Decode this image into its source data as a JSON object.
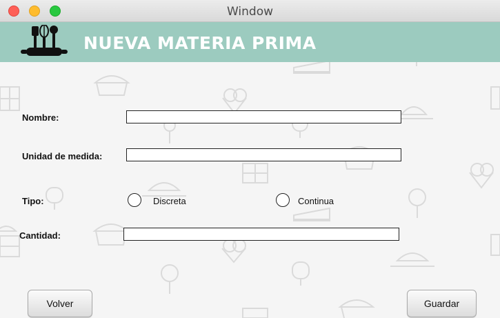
{
  "window": {
    "title": "Window"
  },
  "banner": {
    "title": "NUEVA MATERIA PRIMA",
    "color": "#9ccbbf"
  },
  "form": {
    "nombre": {
      "label": "Nombre:",
      "value": ""
    },
    "unidad": {
      "label": "Unidad de medida:",
      "value": ""
    },
    "tipo": {
      "label": "Tipo:",
      "options": [
        {
          "label": "Discreta",
          "selected": false
        },
        {
          "label": "Continua",
          "selected": false
        }
      ]
    },
    "cantidad": {
      "label": "Cantidad:",
      "value": ""
    }
  },
  "buttons": {
    "back": "Volver",
    "save": "Guardar"
  },
  "icons": [
    "kitchen-utensils-logo-icon",
    "cake-icon",
    "cupcake-icon",
    "chocolate-bar-icon",
    "ice-cream-icon",
    "pudding-icon",
    "lollipop-icon",
    "popsicle-icon"
  ]
}
